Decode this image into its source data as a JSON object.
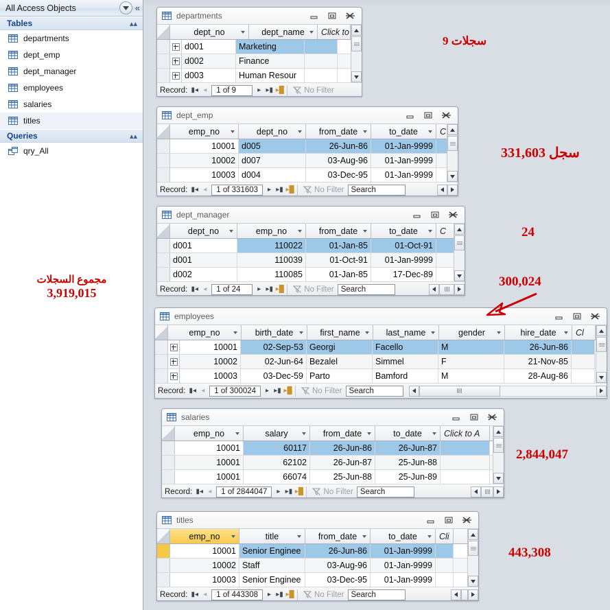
{
  "navpane": {
    "title": "All Access Objects",
    "dropdown_icon": "chevron-down-circle-icon",
    "collapse_icon": "double-chevron-left-icon",
    "groups": [
      {
        "label": "Tables",
        "items": [
          {
            "label": "departments",
            "icon": "table-icon"
          },
          {
            "label": "dept_emp",
            "icon": "table-icon"
          },
          {
            "label": "dept_manager",
            "icon": "table-icon"
          },
          {
            "label": "employees",
            "icon": "table-icon"
          },
          {
            "label": "salaries",
            "icon": "table-icon"
          },
          {
            "label": "titles",
            "icon": "table-icon"
          }
        ]
      },
      {
        "label": "Queries",
        "items": [
          {
            "label": "qry_All",
            "icon": "query-icon"
          }
        ]
      }
    ],
    "total_annotation": {
      "label": "مجموع السجلات",
      "value": "3,919,015"
    }
  },
  "annotations": [
    {
      "id": "departments-count",
      "text": "9 سجلات"
    },
    {
      "id": "dept_emp-count",
      "text": "331,603 سجل"
    },
    {
      "id": "dept_manager-count",
      "text": "24"
    },
    {
      "id": "employees-count",
      "text": "300,024"
    },
    {
      "id": "salaries-count",
      "text": "2,844,047"
    },
    {
      "id": "titles-count",
      "text": "443,308"
    }
  ],
  "colors": {
    "annotation": "#cc0000",
    "selection": "#9ec8e8",
    "primary_key": "#f6c944",
    "workspace": "#d9dee5",
    "group_header_text": "#14438b"
  },
  "window_controls": {
    "minimize": "minimize-icon",
    "restore": "restore-icon",
    "close": "close-icon"
  },
  "nav_labels": {
    "record": "Record:",
    "first": "first-record-icon",
    "previous": "previous-record-icon",
    "next": "next-record-icon",
    "last": "last-record-icon",
    "new": "new-record-icon",
    "no_filter": "No Filter",
    "search_placeholder": "Search"
  },
  "windows": [
    {
      "title": "departments",
      "columns": [
        "dept_no",
        "dept_name",
        "Click to Add"
      ],
      "rows": [
        {
          "expand": true,
          "cells": [
            "d001",
            "Marketing",
            ""
          ]
        },
        {
          "expand": true,
          "cells": [
            "d002",
            "Finance",
            ""
          ]
        },
        {
          "expand": true,
          "cells": [
            "d003",
            "Human Resour",
            ""
          ]
        }
      ],
      "record_text": "1 of 9",
      "has_search": false
    },
    {
      "title": "dept_emp",
      "columns": [
        "emp_no",
        "dept_no",
        "from_date",
        "to_date",
        "C"
      ],
      "rows": [
        {
          "expand": false,
          "cells": [
            "10001",
            "d005",
            "26-Jun-86",
            "01-Jan-9999",
            ""
          ]
        },
        {
          "expand": false,
          "cells": [
            "10002",
            "d007",
            "03-Aug-96",
            "01-Jan-9999",
            ""
          ]
        },
        {
          "expand": false,
          "cells": [
            "10003",
            "d004",
            "03-Dec-95",
            "01-Jan-9999",
            ""
          ]
        }
      ],
      "record_text": "1 of 331603",
      "has_search": true
    },
    {
      "title": "dept_manager",
      "columns": [
        "dept_no",
        "emp_no",
        "from_date",
        "to_date",
        "C"
      ],
      "rows": [
        {
          "expand": false,
          "cells": [
            "d001",
            "110022",
            "01-Jan-85",
            "01-Oct-91",
            ""
          ]
        },
        {
          "expand": false,
          "cells": [
            "d001",
            "110039",
            "01-Oct-91",
            "01-Jan-9999",
            ""
          ]
        },
        {
          "expand": false,
          "cells": [
            "d002",
            "110085",
            "01-Jan-85",
            "17-Dec-89",
            ""
          ]
        }
      ],
      "record_text": "1 of 24",
      "has_search": true
    },
    {
      "title": "employees",
      "columns": [
        "emp_no",
        "birth_date",
        "first_name",
        "last_name",
        "gender",
        "hire_date",
        "Cl"
      ],
      "rows": [
        {
          "expand": true,
          "cells": [
            "10001",
            "02-Sep-53",
            "Georgi",
            "Facello",
            "M",
            "26-Jun-86",
            ""
          ]
        },
        {
          "expand": true,
          "cells": [
            "10002",
            "02-Jun-64",
            "Bezalel",
            "Simmel",
            "F",
            "21-Nov-85",
            ""
          ]
        },
        {
          "expand": true,
          "cells": [
            "10003",
            "03-Dec-59",
            "Parto",
            "Bamford",
            "M",
            "28-Aug-86",
            ""
          ]
        }
      ],
      "record_text": "1 of 300024",
      "has_search": true
    },
    {
      "title": "salaries",
      "columns": [
        "emp_no",
        "salary",
        "from_date",
        "to_date",
        "Click to A"
      ],
      "rows": [
        {
          "expand": false,
          "cells": [
            "10001",
            "60117",
            "26-Jun-86",
            "26-Jun-87",
            ""
          ]
        },
        {
          "expand": false,
          "cells": [
            "10001",
            "62102",
            "26-Jun-87",
            "25-Jun-88",
            ""
          ]
        },
        {
          "expand": false,
          "cells": [
            "10001",
            "66074",
            "25-Jun-88",
            "25-Jun-89",
            ""
          ]
        }
      ],
      "record_text": "1 of 2844047",
      "has_search": true
    },
    {
      "title": "titles",
      "columns": [
        "emp_no",
        "title",
        "from_date",
        "to_date",
        "Cli"
      ],
      "rows": [
        {
          "expand": false,
          "cells": [
            "10001",
            "Senior Enginee",
            "26-Jun-86",
            "01-Jan-9999",
            ""
          ]
        },
        {
          "expand": false,
          "cells": [
            "10002",
            "Staff",
            "03-Aug-96",
            "01-Jan-9999",
            ""
          ]
        },
        {
          "expand": false,
          "cells": [
            "10003",
            "Senior Enginee",
            "03-Dec-95",
            "01-Jan-9999",
            ""
          ]
        }
      ],
      "record_text": "1 of 443308",
      "has_search": true
    }
  ]
}
